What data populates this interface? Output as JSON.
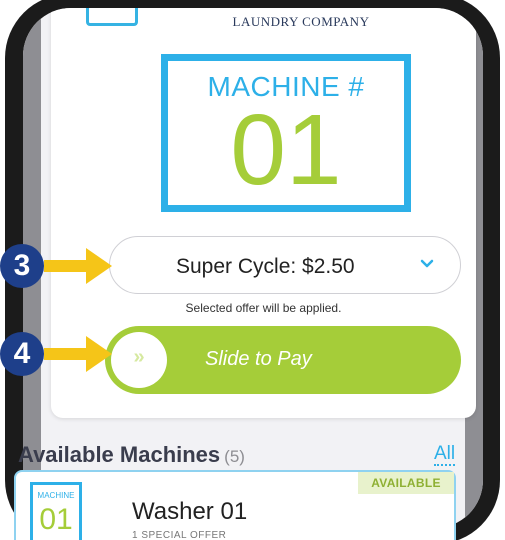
{
  "header": {
    "company_name": "LAUNDRY COMPANY"
  },
  "machine_display": {
    "label": "MACHINE #",
    "number": "01"
  },
  "cycle_select": {
    "selected": "Super Cycle: $2.50",
    "note": "Selected offer will be applied."
  },
  "slide_to_pay": {
    "label": "Slide to Pay",
    "knob_glyph": "»"
  },
  "available_machines": {
    "title": "Available Machines",
    "count": "(5)",
    "all_link": "All",
    "items": [
      {
        "status": "AVAILABLE",
        "icon_label": "MACHINE",
        "icon_number": "01",
        "name": "Washer 01",
        "offer": "1 SPECIAL OFFER"
      }
    ]
  },
  "annotations": {
    "step_3": "3",
    "step_4": "4"
  },
  "colors": {
    "accent_blue": "#2db0e8",
    "accent_green": "#a5cd39",
    "step_badge": "#1e3f8a",
    "arrow_yellow": "#f5c518"
  },
  "icons": {
    "chevron": "chevron-down-icon",
    "slide_knob": "double-chevron-right-icon",
    "step_arrow": "arrow-right-icon"
  }
}
